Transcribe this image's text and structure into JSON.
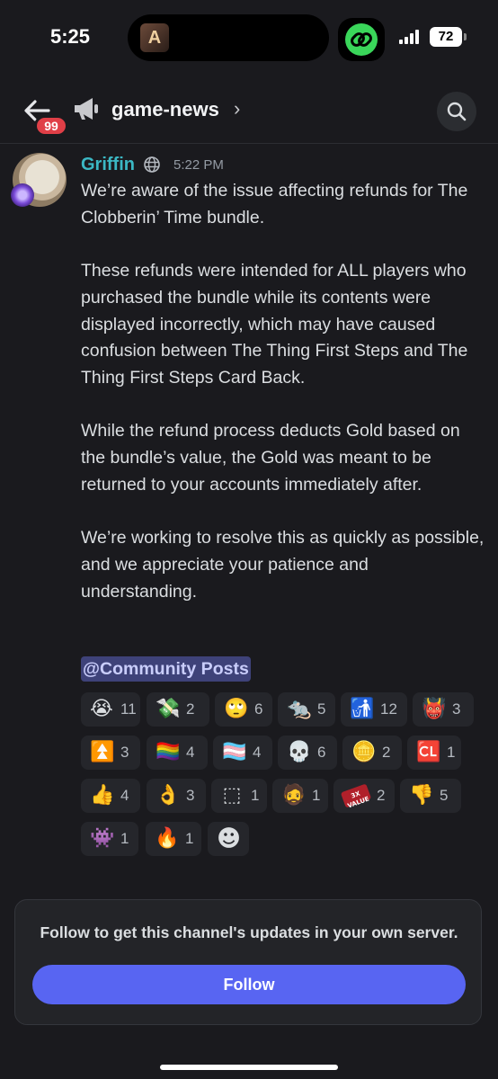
{
  "status_bar": {
    "time": "5:25",
    "battery": "72",
    "island_thumb": "A"
  },
  "header": {
    "channel": "game-news",
    "chevron": "›",
    "badge": "99"
  },
  "message": {
    "author": "Griffin",
    "timestamp": "5:22 PM",
    "paragraphs": [
      "We’re aware of the issue affecting refunds for The Clobberin’ Time bundle.",
      "These refunds were intended for ALL players who purchased the bundle while its contents were displayed incorrectly, which may have caused confusion between The Thing First Steps and The Thing First Steps Card Back.",
      "While the refund process deducts Gold based on the bundle’s value, the Gold was meant to be returned to your accounts immediately after.",
      "We’re working to resolve this as quickly as possible, and we appreciate your patience and understanding."
    ],
    "mention": "@Community Posts"
  },
  "reactions": [
    {
      "emoji": "😭",
      "count": "11"
    },
    {
      "emoji": "💸",
      "count": "2"
    },
    {
      "emoji": "🙄",
      "count": "6"
    },
    {
      "emoji": "🐀",
      "count": "5"
    },
    {
      "emoji": "🚮",
      "count": "12"
    },
    {
      "emoji": "👹",
      "count": "3"
    },
    {
      "emoji": "⏫",
      "count": "3"
    },
    {
      "emoji": "🏳️‍🌈",
      "count": "4"
    },
    {
      "emoji": "🏳️‍⚧️",
      "count": "4"
    },
    {
      "emoji": "💀",
      "count": "6"
    },
    {
      "emoji": "🪙",
      "count": "2"
    },
    {
      "emoji": "🆑",
      "count": "1"
    },
    {
      "emoji": "👍",
      "count": "4"
    },
    {
      "emoji": "👌",
      "count": "3"
    },
    {
      "emoji": "⬚",
      "count": "1"
    },
    {
      "emoji": "🧔",
      "count": "1"
    },
    {
      "emoji": "3X VALUE",
      "count": "2"
    },
    {
      "emoji": "👎",
      "count": "5"
    },
    {
      "emoji": "👾",
      "count": "1"
    },
    {
      "emoji": "🔥",
      "count": "1"
    },
    {
      "emoji": "☻",
      "count": ""
    }
  ],
  "follow": {
    "text": "Follow to get this channel's updates in your own server.",
    "button": "Follow"
  }
}
